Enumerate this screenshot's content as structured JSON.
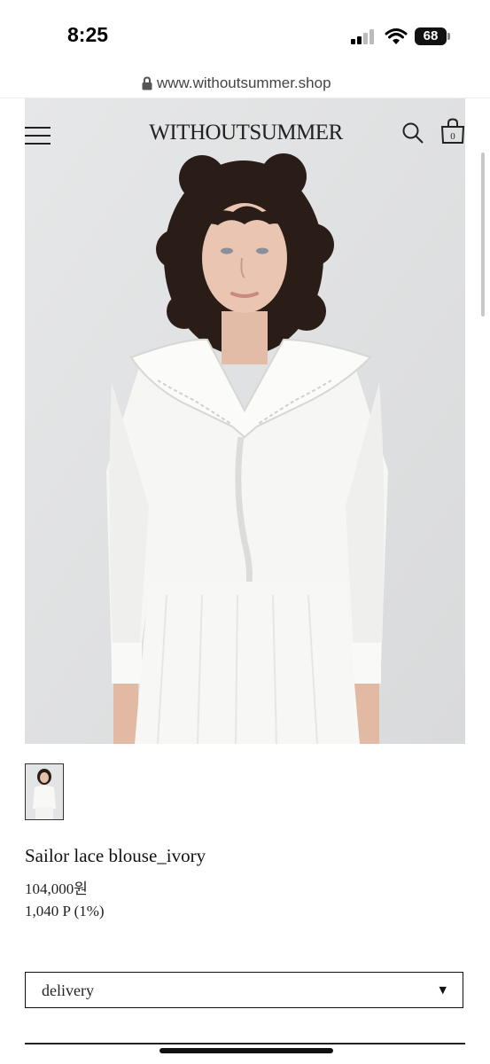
{
  "status_bar": {
    "time": "8:25",
    "battery": "68"
  },
  "browser": {
    "url": "www.withoutsummer.shop"
  },
  "site": {
    "logo": "WITHOUTSUMMER",
    "cart_count": "0"
  },
  "product": {
    "name": "Sailor lace blouse_ivory",
    "price": "104,000원",
    "points": "1,040 P (1%)"
  },
  "options": {
    "delivery_label": "delivery",
    "arrow": "▼"
  },
  "icons": {
    "menu": "hamburger-menu-icon",
    "search": "search-icon",
    "cart": "shopping-bag-icon",
    "lock": "lock-icon",
    "wifi": "wifi-icon",
    "signal": "cellular-signal-icon"
  }
}
